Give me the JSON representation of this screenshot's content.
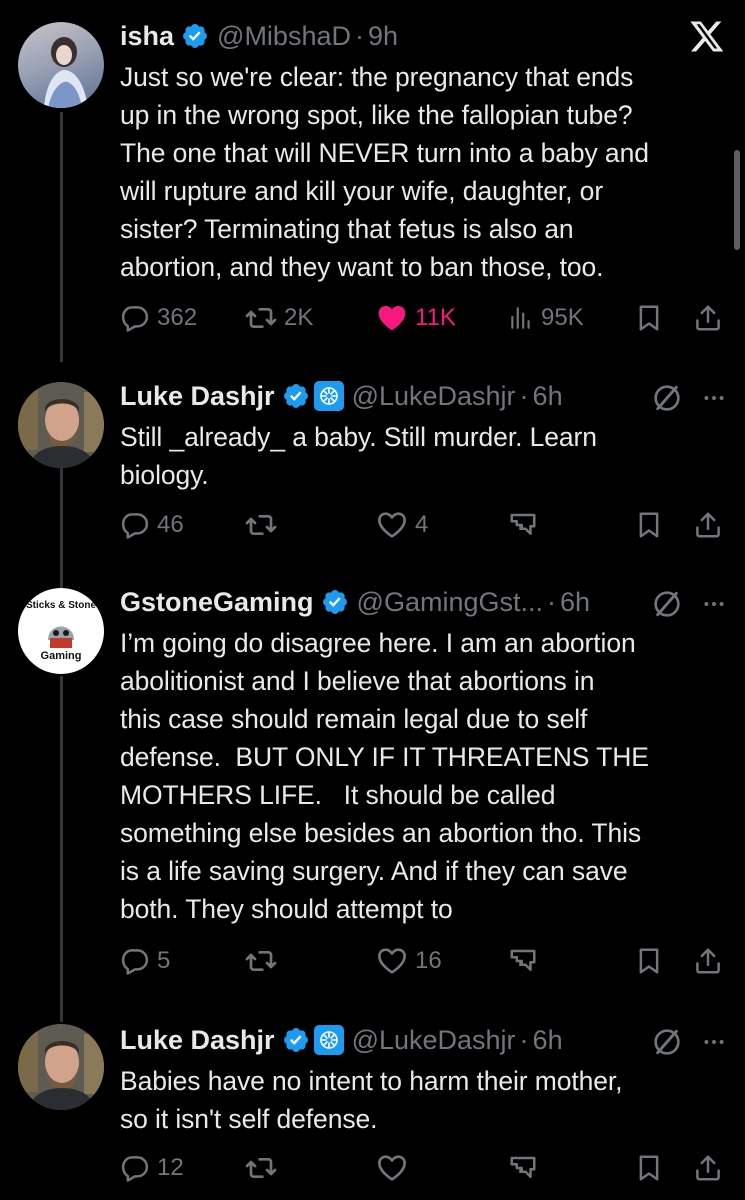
{
  "tweets": [
    {
      "name": "isha",
      "handle": "@MibshaD",
      "time": "9h",
      "text": "Just so we're clear: the pregnancy that ends\nup in the wrong spot, like the fallopian tube?\nThe one that will NEVER turn into a baby and\nwill rupture and kill your wife, daughter, or\nsister? Terminating that fetus is also an\nabortion, and they want to ban those, too.",
      "replies": "362",
      "reposts": "2K",
      "likes": "11K",
      "views": "95K",
      "liked": true
    },
    {
      "name": "Luke Dashjr",
      "handle": "@LukeDashjr",
      "time": "6h",
      "text": "Still _already_ a baby. Still murder. Learn\nbiology.",
      "replies": "46",
      "reposts": "",
      "likes": "4"
    },
    {
      "name": "GstoneGaming",
      "handle": "@GamingGst...",
      "time": "6h",
      "avatar_text_top": "Sticks & Stone",
      "avatar_text_bottom": "Gaming",
      "text": "I’m going do disagree here. I am an abortion\nabolitionist and I believe that abortions in\nthis case should remain legal due to self\ndefense.  BUT ONLY IF IT THREATENS THE\nMOTHERS LIFE.   It should be called\nsomething else besides an abortion tho. This\nis a life saving surgery. And if they can save\nboth. They should attempt to",
      "replies": "5",
      "reposts": "",
      "likes": "16"
    },
    {
      "name": "Luke Dashjr",
      "handle": "@LukeDashjr",
      "time": "6h",
      "text": "Babies have no intent to harm their mother,\nso it isn't self defense.",
      "replies": "12",
      "reposts": "",
      "likes": ""
    }
  ],
  "colors": {
    "background": "#000000",
    "text": "#e7e9ea",
    "muted": "#71767b",
    "like": "#f91880",
    "verified": "#1d9bf0"
  },
  "icons": [
    "x-logo-icon",
    "verified-badge-icon",
    "affiliate-badge-icon",
    "grok-icon",
    "more-icon",
    "reply-icon",
    "repost-icon",
    "like-icon",
    "views-icon",
    "tip-icon",
    "bookmark-icon",
    "share-icon"
  ]
}
